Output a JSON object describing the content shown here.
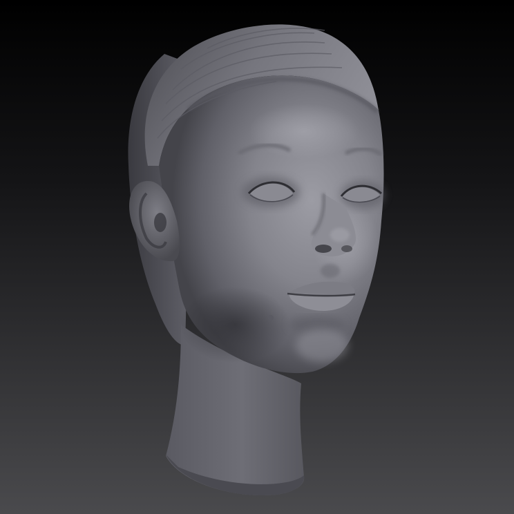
{
  "scene": {
    "subject": "sculpted-head",
    "colors": {
      "background_top": "#000000",
      "background_bottom": "#4a4a4d",
      "clay_light": "#9a9aa2",
      "clay_mid": "#6e6e76",
      "clay_dark": "#3e3e44",
      "clay_shadow": "#2c2c31"
    }
  }
}
